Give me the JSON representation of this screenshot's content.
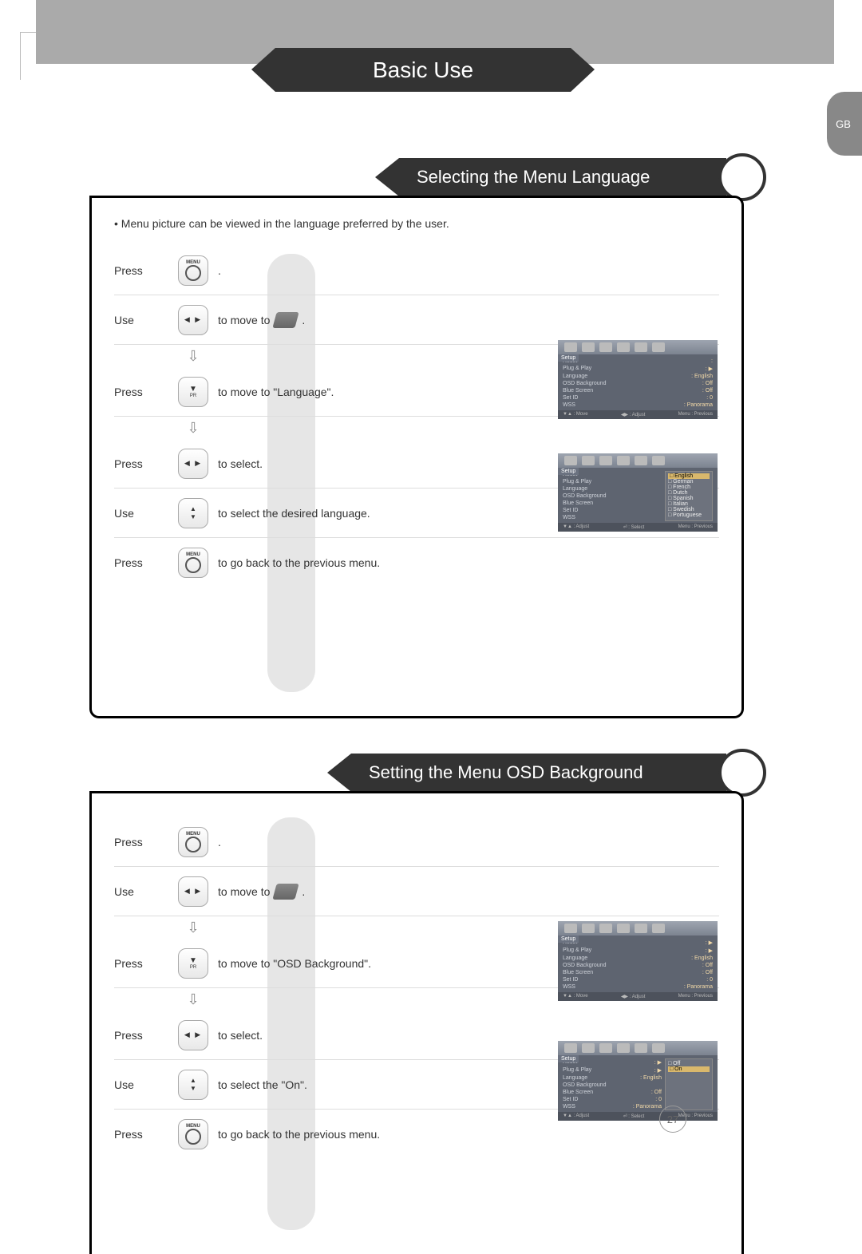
{
  "region_tab": "GB",
  "page_title": "Basic Use",
  "page_number": "27",
  "section1": {
    "title": "Selecting the Menu Language",
    "intro": "• Menu picture can be viewed in the language preferred by the user.",
    "steps": [
      {
        "action": "Press",
        "btn": "MENU",
        "text": "."
      },
      {
        "action": "Use",
        "btn": "LR",
        "text_pre": "to move to",
        "text_post": ".",
        "has_icon": true
      },
      {
        "action": "Press",
        "btn": "DOWN",
        "text": "to move to \"Language\"."
      },
      {
        "action": "Press",
        "btn": "LR",
        "text": "to select."
      },
      {
        "action": "Use",
        "btn": "UD",
        "text": "to select the desired language."
      },
      {
        "action": "Press",
        "btn": "MENU",
        "text": "to go back to the previous menu."
      }
    ],
    "osd1": {
      "setup": "Setup",
      "rows": [
        [
          "Reset",
          ":"
        ],
        [
          "Plug & Play",
          ": ▶"
        ],
        [
          "Language",
          ": English"
        ],
        [
          "OSD Background",
          ": Off"
        ],
        [
          "Blue Screen",
          ": Off"
        ],
        [
          "Set ID",
          ": 0"
        ],
        [
          "WSS",
          ": Panorama"
        ]
      ],
      "footer": [
        "▼▲ : Move",
        "◀▶ : Adjust",
        "Menu : Previous"
      ]
    },
    "osd2": {
      "setup": "Setup",
      "left": [
        "Reset",
        "Plug & Play",
        "Language",
        "OSD Background",
        "Blue Screen",
        "Set ID",
        "WSS"
      ],
      "popup": [
        "English",
        "German",
        "French",
        "Dutch",
        "Spanish",
        "Italian",
        "Swedish",
        "Portuguese"
      ],
      "popup_selected": 0,
      "footer": [
        "▼▲ : Adjust",
        "⏎ : Select",
        "Menu : Previous"
      ]
    }
  },
  "section2": {
    "title": "Setting the Menu OSD Background",
    "steps": [
      {
        "action": "Press",
        "btn": "MENU",
        "text": "."
      },
      {
        "action": "Use",
        "btn": "LR",
        "text_pre": "to move to",
        "text_post": ".",
        "has_icon": true
      },
      {
        "action": "Press",
        "btn": "DOWN",
        "text": "to move to \"OSD Background\"."
      },
      {
        "action": "Press",
        "btn": "LR",
        "text": "to select."
      },
      {
        "action": "Use",
        "btn": "UD",
        "text": "to select the \"On\"."
      },
      {
        "action": "Press",
        "btn": "MENU",
        "text": "to go back to the previous menu."
      }
    ],
    "osd1": {
      "setup": "Setup",
      "rows": [
        [
          "Reset",
          ": ▶"
        ],
        [
          "Plug & Play",
          ": ▶"
        ],
        [
          "Language",
          ": English"
        ],
        [
          "OSD Background",
          ": Off"
        ],
        [
          "Blue Screen",
          ": Off"
        ],
        [
          "Set ID",
          ": 0"
        ],
        [
          "WSS",
          ": Panorama"
        ]
      ],
      "footer": [
        "▼▲ : Move",
        "◀▶ : Adjust",
        "Menu : Previous"
      ]
    },
    "osd2": {
      "setup": "Setup",
      "left": [
        [
          "Reset",
          ": ▶"
        ],
        [
          "Plug & Play",
          ": ▶"
        ],
        [
          "Language",
          ": English"
        ],
        [
          "OSD Background",
          ""
        ],
        [
          "Blue Screen",
          ": Off"
        ],
        [
          "Set ID",
          ": 0"
        ],
        [
          "WSS",
          ": Panorama"
        ]
      ],
      "popup": [
        "Off",
        "On"
      ],
      "popup_selected": 1,
      "footer": [
        "▼▲ : Adjust",
        "⏎ : Select",
        "Menu : Previous"
      ]
    }
  }
}
